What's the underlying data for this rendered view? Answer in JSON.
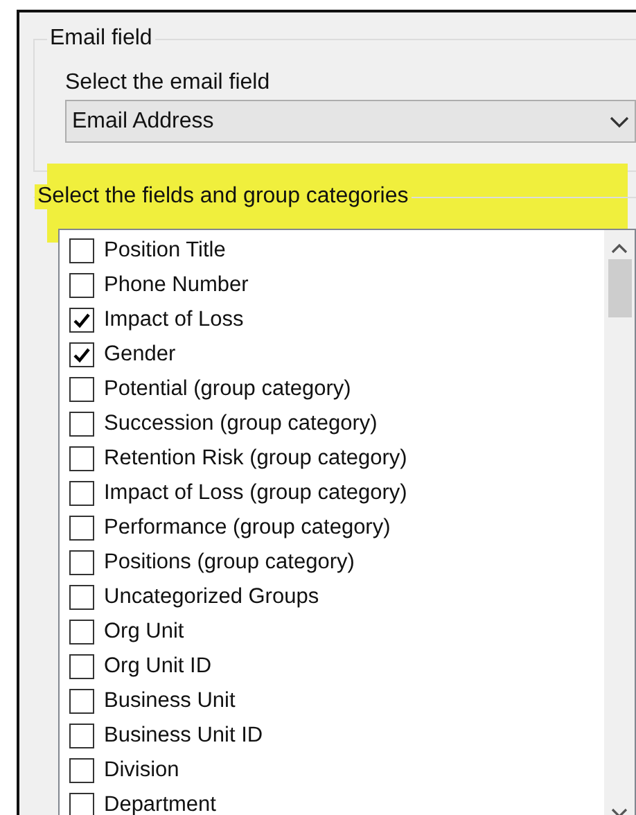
{
  "email_group": {
    "title": "Email field",
    "label": "Select the email field",
    "select": {
      "value": "Email Address"
    }
  },
  "fields_group": {
    "title": "Select the fields and group categories",
    "items": [
      {
        "label": "Position Title",
        "checked": false
      },
      {
        "label": "Phone Number",
        "checked": false
      },
      {
        "label": "Impact of Loss",
        "checked": true
      },
      {
        "label": "Gender",
        "checked": true
      },
      {
        "label": "Potential (group category)",
        "checked": false
      },
      {
        "label": "Succession (group category)",
        "checked": false
      },
      {
        "label": "Retention Risk (group category)",
        "checked": false
      },
      {
        "label": "Impact of Loss (group category)",
        "checked": false
      },
      {
        "label": "Performance (group category)",
        "checked": false
      },
      {
        "label": "Positions (group category)",
        "checked": false
      },
      {
        "label": "Uncategorized Groups",
        "checked": false
      },
      {
        "label": "Org Unit",
        "checked": false
      },
      {
        "label": "Org Unit ID",
        "checked": false
      },
      {
        "label": "Business Unit",
        "checked": false
      },
      {
        "label": "Business Unit ID",
        "checked": false
      },
      {
        "label": "Division",
        "checked": false
      },
      {
        "label": "Department",
        "checked": false
      }
    ]
  }
}
